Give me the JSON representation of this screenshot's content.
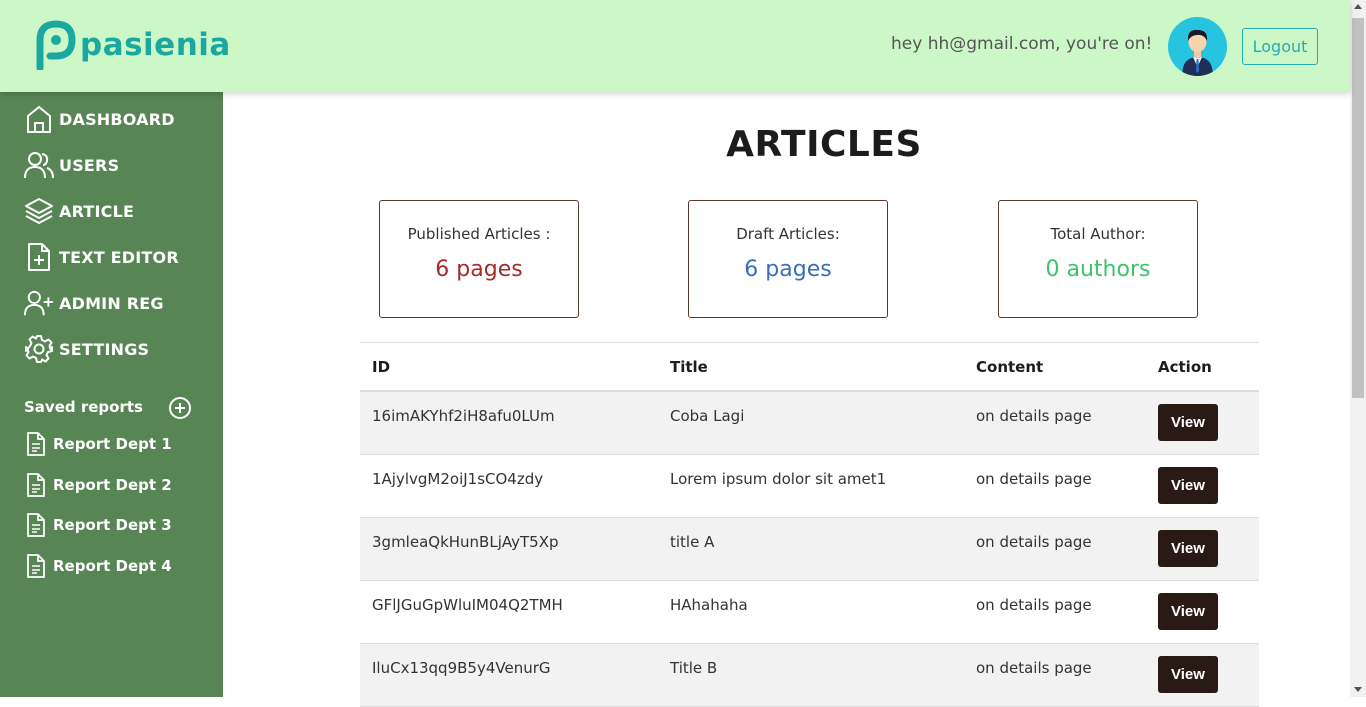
{
  "header": {
    "brand": "pasienia",
    "greeting": "hey hh@gmail.com, you're on!",
    "logout_label": "Logout"
  },
  "sidebar": {
    "items": [
      {
        "label": "DASHBOARD",
        "icon": "home-icon"
      },
      {
        "label": "USERS",
        "icon": "users-icon"
      },
      {
        "label": "ARTICLE",
        "icon": "layers-icon"
      },
      {
        "label": "TEXT EDITOR",
        "icon": "file-plus-icon"
      },
      {
        "label": "ADMIN REG",
        "icon": "user-plus-icon"
      },
      {
        "label": "SETTINGS",
        "icon": "gear-icon"
      }
    ],
    "saved_title": "Saved reports",
    "reports": [
      "Report Dept 1",
      "Report Dept 2",
      "Report Dept 3",
      "Report Dept 4"
    ]
  },
  "main": {
    "title": "ARTICLES",
    "stats": [
      {
        "label": "Published Articles :",
        "value": "6 pages",
        "color": "#a52a2a"
      },
      {
        "label": "Draft Articles:",
        "value": "6 pages",
        "color": "#3a6fb8"
      },
      {
        "label": "Total Author:",
        "value": "0 authors",
        "color": "#3cc46a"
      }
    ],
    "table": {
      "headers": [
        "ID",
        "Title",
        "Content",
        "Action"
      ],
      "rows": [
        {
          "id": "16imAKYhf2iH8afu0LUm",
          "title": "Coba Lagi",
          "content": "on details page",
          "action": "View"
        },
        {
          "id": "1AjylvgM2oiJ1sCO4zdy",
          "title": "Lorem ipsum dolor sit amet1",
          "content": "on details page",
          "action": "View"
        },
        {
          "id": "3gmleaQkHunBLjAyT5Xp",
          "title": "title A",
          "content": "on details page",
          "action": "View"
        },
        {
          "id": "GFlJGuGpWluIM04Q2TMH",
          "title": "HAhahaha",
          "content": "on details page",
          "action": "View"
        },
        {
          "id": "IluCx13qq9B5y4VenurG",
          "title": "Title B",
          "content": "on details page",
          "action": "View"
        }
      ]
    }
  },
  "colors": {
    "header_bg": "#ccf8c8",
    "sidebar_bg": "#578554",
    "brand": "#1aa8a0",
    "view_button": "#2a1a16"
  }
}
